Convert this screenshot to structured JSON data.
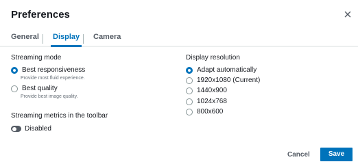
{
  "dialog": {
    "title": "Preferences"
  },
  "tabs": [
    {
      "label": "General",
      "active": false
    },
    {
      "label": "Display",
      "active": true
    },
    {
      "label": "Camera",
      "active": false
    }
  ],
  "streaming_mode": {
    "title": "Streaming mode",
    "options": [
      {
        "label": "Best responsiveness",
        "description": "Provide most fluid experience.",
        "checked": true
      },
      {
        "label": "Best quality",
        "description": "Provide best image quality.",
        "checked": false
      }
    ]
  },
  "metrics": {
    "title": "Streaming metrics in the toolbar",
    "toggle_label": "Disabled",
    "enabled": false
  },
  "display_resolution": {
    "title": "Display resolution",
    "options": [
      {
        "label": "Adapt automatically",
        "checked": true
      },
      {
        "label": "1920x1080 (Current)",
        "checked": false
      },
      {
        "label": "1440x900",
        "checked": false
      },
      {
        "label": "1024x768",
        "checked": false
      },
      {
        "label": "800x600",
        "checked": false
      }
    ]
  },
  "footer": {
    "cancel_label": "Cancel",
    "save_label": "Save"
  },
  "colors": {
    "accent": "#0073bb",
    "text": "#16191f",
    "muted": "#687078"
  }
}
